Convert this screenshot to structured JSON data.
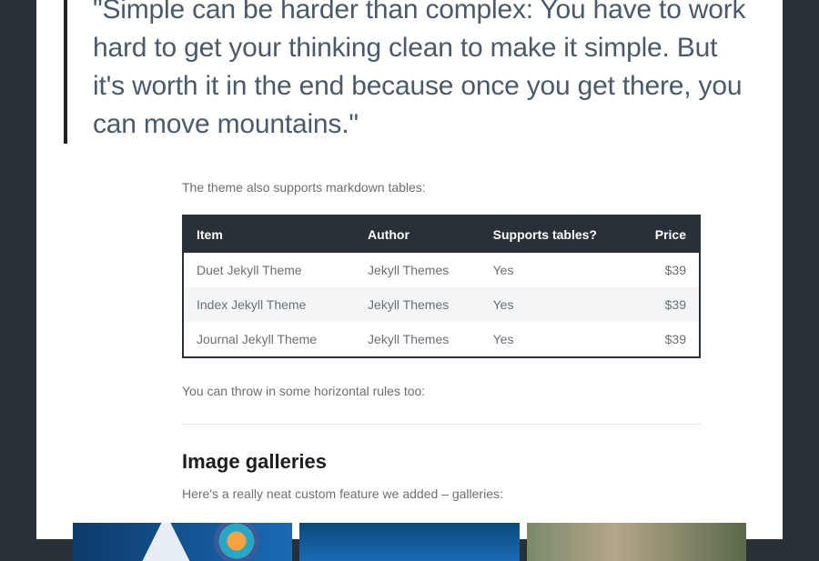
{
  "quote": "\"Simple can be harder than complex: You have to work hard to get your thinking clean to make it simple. But it's worth it in the end because once you get there, you can move mountains.\"",
  "table_intro": "The theme also supports markdown tables:",
  "table": {
    "headers": [
      "Item",
      "Author",
      "Supports tables?",
      "Price"
    ],
    "rows": [
      {
        "item": "Duet Jekyll Theme",
        "author": "Jekyll Themes",
        "supports": "Yes",
        "price": "$39"
      },
      {
        "item": "Index Jekyll Theme",
        "author": "Jekyll Themes",
        "supports": "Yes",
        "price": "$39"
      },
      {
        "item": "Journal Jekyll Theme",
        "author": "Jekyll Themes",
        "supports": "Yes",
        "price": "$39"
      }
    ]
  },
  "hr_note": "You can throw in some horizontal rules too:",
  "gallery_heading": "Image galleries",
  "gallery_intro": "Here's a really neat custom feature we added – galleries:"
}
